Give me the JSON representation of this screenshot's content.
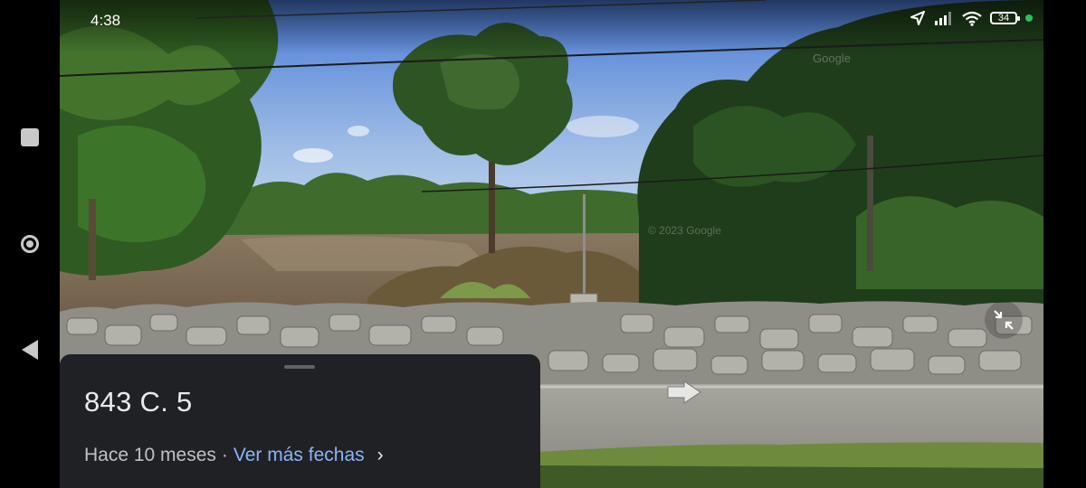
{
  "status_bar": {
    "time": "4:38",
    "battery": "34",
    "icons": [
      "location-arrow-icon",
      "signal-icon",
      "wifi-icon",
      "battery-icon",
      "privacy-dot-icon"
    ]
  },
  "watermark": {
    "text_1": "Google",
    "text_2": "© 2023 Google"
  },
  "panel": {
    "address": "843 C. 5",
    "date_text": "Hace 10 meses",
    "separator": "·",
    "more_dates_link": "Ver más fechas",
    "chevron": "›"
  },
  "nav_bar": {
    "buttons": [
      "recents-square-icon",
      "home-circle-icon",
      "back-triangle-icon"
    ]
  },
  "colors": {
    "panel_bg": "#202124",
    "link": "#8ab4f8",
    "status_dot": "#22c55e"
  }
}
